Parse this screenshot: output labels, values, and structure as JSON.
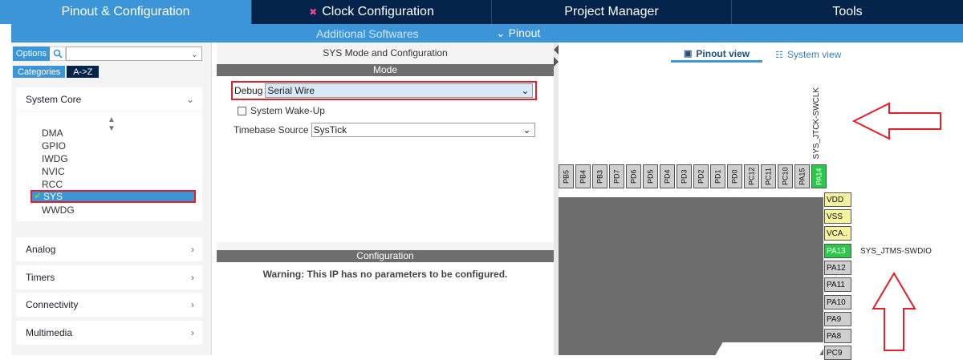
{
  "top_tabs": [
    "Pinout & Configuration",
    "Clock Configuration",
    "Project Manager",
    "Tools"
  ],
  "sub_bar": {
    "additional": "Additional Softwares",
    "pinout": "Pinout"
  },
  "left": {
    "options_label": "Options",
    "categories_label": "Categories",
    "az_label": "A->Z",
    "groups": [
      "System Core",
      "Analog",
      "Timers",
      "Connectivity",
      "Multimedia"
    ],
    "system_core_items": [
      "DMA",
      "GPIO",
      "IWDG",
      "NVIC",
      "RCC",
      "SYS",
      "WWDG"
    ],
    "selected_item": "SYS"
  },
  "mid": {
    "title": "SYS Mode and Configuration",
    "mode_header": "Mode",
    "debug_label": "Debug",
    "debug_value": "Serial Wire",
    "wakeup_label": "System Wake-Up",
    "timebase_label": "Timebase Source",
    "timebase_value": "SysTick",
    "config_header": "Configuration",
    "warning": "Warning: This IP has no parameters to be configured."
  },
  "right": {
    "pinout_view": "Pinout view",
    "system_view": "System view",
    "swclk_label": "SYS_JTCK-SWCLK",
    "swdio_label": "SYS_JTMS-SWDIO",
    "top_pins": [
      "PB5",
      "PB4",
      "PB3",
      "PD7",
      "PD6",
      "PD5",
      "PD4",
      "PD3",
      "PD2",
      "PD1",
      "PD0",
      "PC12",
      "PC11",
      "PC10",
      "PA15",
      "PA14"
    ],
    "right_pins": [
      "VDD",
      "VSS",
      "VCA..",
      "PA13",
      "PA12",
      "PA11",
      "PA10",
      "PA9",
      "PA8",
      "PC9"
    ]
  },
  "colors": {
    "brand_dark": "#03234b",
    "accent": "#3c95d6",
    "highlight_red": "#e0202a",
    "pin_green": "#2cc84a",
    "pin_yellow": "#f6f3a0"
  }
}
